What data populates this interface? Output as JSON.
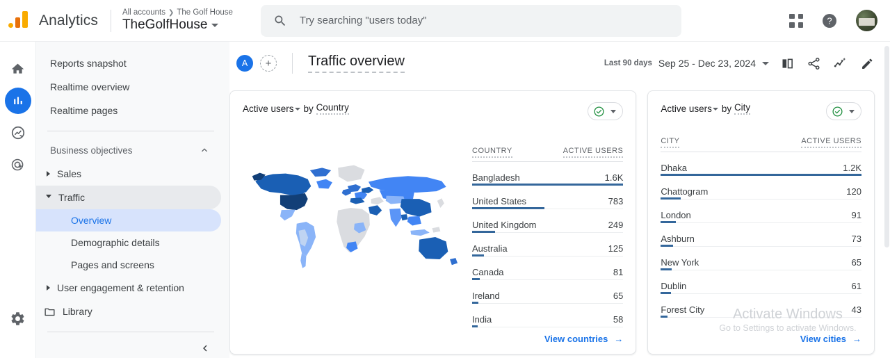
{
  "topbar": {
    "logo_icon": "analytics-logo-icon",
    "brand": "Analytics",
    "breadcrumb_root": "All accounts",
    "breadcrumb_sep": "❯",
    "breadcrumb_current": "The Golf House",
    "account_name": "TheGolfHouse",
    "search_placeholder": "Try searching \"users today\"",
    "search_value": "",
    "search_icon": "search-icon",
    "apps_icon": "apps-grid-icon",
    "help_icon": "help-circle-icon",
    "avatar": "user-avatar"
  },
  "rail": [
    {
      "icon": "home-icon",
      "name": "home",
      "active": false
    },
    {
      "icon": "reports-bar-chart-icon",
      "name": "reports",
      "active": true
    },
    {
      "icon": "explore-icon",
      "name": "explore",
      "active": false
    },
    {
      "icon": "advertising-target-icon",
      "name": "advertising",
      "active": false
    }
  ],
  "rail_gear": {
    "icon": "gear-icon",
    "name": "admin"
  },
  "nav": {
    "items": [
      {
        "label": "Reports snapshot"
      },
      {
        "label": "Realtime overview"
      },
      {
        "label": "Realtime pages"
      }
    ],
    "group_label": "Business objectives",
    "group_collapse_icon": "chevron-up-icon",
    "sections": [
      {
        "label": "Sales",
        "expanded": false
      },
      {
        "label": "Traffic",
        "expanded": true
      }
    ],
    "traffic_children": [
      {
        "label": "Overview",
        "active": true
      },
      {
        "label": "Demographic details",
        "active": false
      },
      {
        "label": "Pages and screens",
        "active": false
      }
    ],
    "engagement_label": "User engagement & retention",
    "library_label": "Library",
    "library_icon": "folder-icon",
    "collapse_icon": "chevron-left-icon"
  },
  "page": {
    "badge": "A",
    "add_label": "+",
    "title": "Traffic overview",
    "date_label": "Last 90 days",
    "date_value": "Sep 25 - Dec 23, 2024",
    "tools": [
      {
        "icon": "compare-icon",
        "name": "compare"
      },
      {
        "icon": "share-icon",
        "name": "share"
      },
      {
        "icon": "insights-icon",
        "name": "insights"
      },
      {
        "icon": "edit-pencil-icon",
        "name": "edit"
      }
    ]
  },
  "country_card": {
    "metric": "Active users",
    "by": "by",
    "dimension": "Country",
    "status_icon": "green-check-circle-icon",
    "columns": [
      "COUNTRY",
      "ACTIVE USERS"
    ],
    "rows": [
      {
        "name": "Bangladesh",
        "value": "1.6K",
        "pct": 100
      },
      {
        "name": "United States",
        "value": "783",
        "pct": 48
      },
      {
        "name": "United Kingdom",
        "value": "249",
        "pct": 15
      },
      {
        "name": "Australia",
        "value": "125",
        "pct": 8
      },
      {
        "name": "Canada",
        "value": "81",
        "pct": 5
      },
      {
        "name": "Ireland",
        "value": "65",
        "pct": 4
      },
      {
        "name": "India",
        "value": "58",
        "pct": 3.5
      }
    ],
    "footer_link": "View countries",
    "footer_arrow": "→"
  },
  "city_card": {
    "metric": "Active users",
    "by": "by",
    "dimension": "City",
    "status_icon": "green-check-circle-icon",
    "columns": [
      "CITY",
      "ACTIVE USERS"
    ],
    "rows": [
      {
        "name": "Dhaka",
        "value": "1.2K",
        "pct": 100
      },
      {
        "name": "Chattogram",
        "value": "120",
        "pct": 10
      },
      {
        "name": "London",
        "value": "91",
        "pct": 7.5
      },
      {
        "name": "Ashburn",
        "value": "73",
        "pct": 6
      },
      {
        "name": "New York",
        "value": "65",
        "pct": 5.4
      },
      {
        "name": "Dublin",
        "value": "61",
        "pct": 5
      },
      {
        "name": "Forest City",
        "value": "43",
        "pct": 3.5
      }
    ],
    "footer_link": "View cities",
    "footer_arrow": "→"
  },
  "chart_data": {
    "type": "heatmap",
    "title": "Active users by Country",
    "legend_position": "none",
    "map_scale": [
      "#bfd4f2",
      "#8ab4f8",
      "#4285f4",
      "#1a5fb4",
      "#e0e2e5"
    ],
    "regions": [
      {
        "name": "United States",
        "value": 783,
        "shade": "#1a5fb4"
      },
      {
        "name": "Canada",
        "value": 81,
        "shade": "#2f6fd0"
      },
      {
        "name": "Russia",
        "value": 40,
        "shade": "#4285f4"
      },
      {
        "name": "China",
        "value": 35,
        "shade": "#2f6fd0"
      },
      {
        "name": "India",
        "value": 58,
        "shade": "#5b95f7"
      },
      {
        "name": "Australia",
        "value": 125,
        "shade": "#1a5fb4"
      },
      {
        "name": "Brazil",
        "value": 20,
        "shade": "#8ab4f8"
      },
      {
        "name": "United Kingdom",
        "value": 249,
        "shade": "#2f6fd0"
      },
      {
        "name": "Bangladesh",
        "value": 1600,
        "shade": "#1a5fb4"
      },
      {
        "name": "No data",
        "value": 0,
        "shade": "#e0e2e5"
      }
    ]
  },
  "watermark": {
    "line1": "Activate Windows",
    "line2": "Go to Settings to activate Windows."
  }
}
